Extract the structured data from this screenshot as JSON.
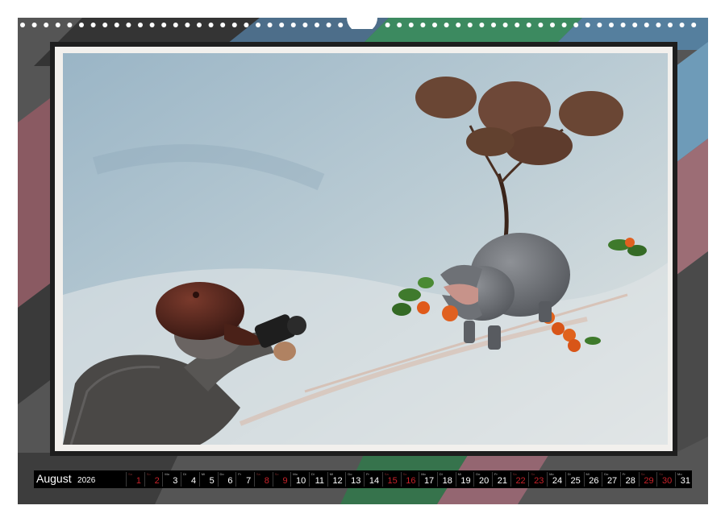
{
  "calendar": {
    "month": "August",
    "year": "2026",
    "days": [
      {
        "day": "1",
        "weekday": "Sa",
        "weekend": true
      },
      {
        "day": "2",
        "weekday": "So",
        "weekend": true
      },
      {
        "day": "3",
        "weekday": "Mo",
        "weekend": false
      },
      {
        "day": "4",
        "weekday": "Di",
        "weekend": false
      },
      {
        "day": "5",
        "weekday": "Mi",
        "weekend": false
      },
      {
        "day": "6",
        "weekday": "Do",
        "weekend": false
      },
      {
        "day": "7",
        "weekday": "Fr",
        "weekend": false
      },
      {
        "day": "8",
        "weekday": "Sa",
        "weekend": true
      },
      {
        "day": "9",
        "weekday": "So",
        "weekend": true
      },
      {
        "day": "10",
        "weekday": "Mo",
        "weekend": false
      },
      {
        "day": "11",
        "weekday": "Di",
        "weekend": false
      },
      {
        "day": "12",
        "weekday": "Mi",
        "weekend": false
      },
      {
        "day": "13",
        "weekday": "Do",
        "weekend": false
      },
      {
        "day": "14",
        "weekday": "Fr",
        "weekend": false
      },
      {
        "day": "15",
        "weekday": "Sa",
        "weekend": true
      },
      {
        "day": "16",
        "weekday": "So",
        "weekend": true
      },
      {
        "day": "17",
        "weekday": "Mo",
        "weekend": false
      },
      {
        "day": "18",
        "weekday": "Di",
        "weekend": false
      },
      {
        "day": "19",
        "weekday": "Mi",
        "weekend": false
      },
      {
        "day": "20",
        "weekday": "Do",
        "weekend": false
      },
      {
        "day": "21",
        "weekday": "Fr",
        "weekend": false
      },
      {
        "day": "22",
        "weekday": "Sa",
        "weekend": true
      },
      {
        "day": "23",
        "weekday": "So",
        "weekend": true
      },
      {
        "day": "24",
        "weekday": "Mo",
        "weekend": false
      },
      {
        "day": "25",
        "weekday": "Di",
        "weekend": false
      },
      {
        "day": "26",
        "weekday": "Mi",
        "weekend": false
      },
      {
        "day": "27",
        "weekday": "Do",
        "weekend": false
      },
      {
        "day": "28",
        "weekday": "Fr",
        "weekend": false
      },
      {
        "day": "29",
        "weekday": "Sa",
        "weekend": true
      },
      {
        "day": "30",
        "weekday": "So",
        "weekend": true
      },
      {
        "day": "31",
        "weekday": "Mo",
        "weekend": false
      }
    ]
  },
  "colors": {
    "weekend": "#c8222a",
    "weekday": "#ffffff",
    "page_background": "#575757",
    "frame": "#1e1e1e"
  }
}
